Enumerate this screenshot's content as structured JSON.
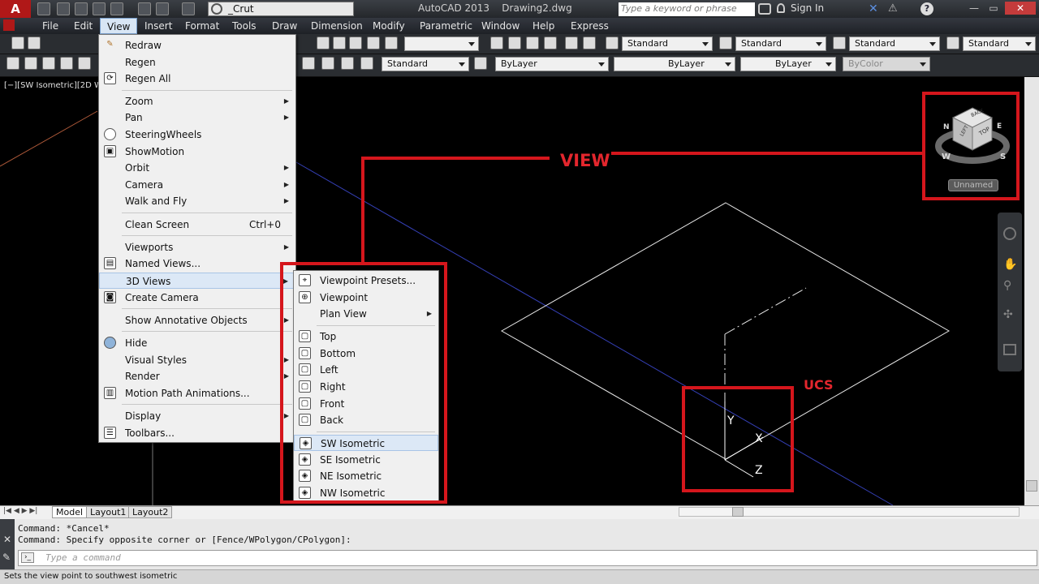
{
  "titlebar": {
    "app_logo": "A",
    "workspace": "_Crut",
    "title": "AutoCAD 2013    Drawing2.dwg",
    "search_placeholder": "Type a keyword or phrase",
    "signin": "Sign In"
  },
  "menubar": {
    "items": [
      "File",
      "Edit",
      "View",
      "Insert",
      "Format",
      "Tools",
      "Draw",
      "Dimension",
      "Modify",
      "Parametric",
      "Window",
      "Help",
      "Express"
    ]
  },
  "toolbar1": {
    "styles": [
      "Standard",
      "Standard",
      "Standard",
      "Standard"
    ]
  },
  "toolbar2": {
    "text_style": "Standard",
    "layer": "ByLayer",
    "linetype": "ByLayer",
    "lineweight": "ByLayer",
    "color": "ByColor"
  },
  "viewport_label": "[−][SW Isometric][2D W",
  "view_menu": {
    "items": [
      {
        "label": "Redraw"
      },
      {
        "label": "Regen"
      },
      {
        "label": "Regen All"
      },
      {
        "label": "Zoom"
      },
      {
        "label": "Pan"
      },
      {
        "label": "SteeringWheels"
      },
      {
        "label": "ShowMotion"
      },
      {
        "label": "Orbit"
      },
      {
        "label": "Camera"
      },
      {
        "label": "Walk and Fly"
      },
      {
        "label": "Clean Screen",
        "shortcut": "Ctrl+0"
      },
      {
        "label": "Viewports"
      },
      {
        "label": "Named Views..."
      },
      {
        "label": "3D Views"
      },
      {
        "label": "Create Camera"
      },
      {
        "label": "Show Annotative Objects"
      },
      {
        "label": "Hide"
      },
      {
        "label": "Visual Styles"
      },
      {
        "label": "Render"
      },
      {
        "label": "Motion Path Animations..."
      },
      {
        "label": "Display"
      },
      {
        "label": "Toolbars..."
      }
    ]
  },
  "views_submenu": {
    "items": [
      {
        "label": "Viewpoint Presets..."
      },
      {
        "label": "Viewpoint"
      },
      {
        "label": "Plan View"
      },
      {
        "label": "Top"
      },
      {
        "label": "Bottom"
      },
      {
        "label": "Left"
      },
      {
        "label": "Right"
      },
      {
        "label": "Front"
      },
      {
        "label": "Back"
      },
      {
        "label": "SW Isometric"
      },
      {
        "label": "SE Isometric"
      },
      {
        "label": "NE Isometric"
      },
      {
        "label": "NW Isometric"
      }
    ]
  },
  "annotations": {
    "view": "VIEW",
    "ucs": "UCS"
  },
  "viewcube": {
    "top": "TOP",
    "left": "LEFT",
    "front": "BACK",
    "compass": [
      "N",
      "E",
      "S",
      "W"
    ],
    "unnamed": "Unnamed"
  },
  "ucs_axes": {
    "x": "X",
    "y": "Y",
    "z": "Z"
  },
  "tabs": [
    "Model",
    "Layout1",
    "Layout2"
  ],
  "command": {
    "history": "Command: *Cancel*\nCommand: Specify opposite corner or [Fence/WPolygon/CPolygon]:",
    "placeholder": "Type a command"
  },
  "status": "Sets the view point to southwest isometric",
  "colors": {
    "annotation": "#d5161c",
    "highlight": "#dce8f6"
  }
}
